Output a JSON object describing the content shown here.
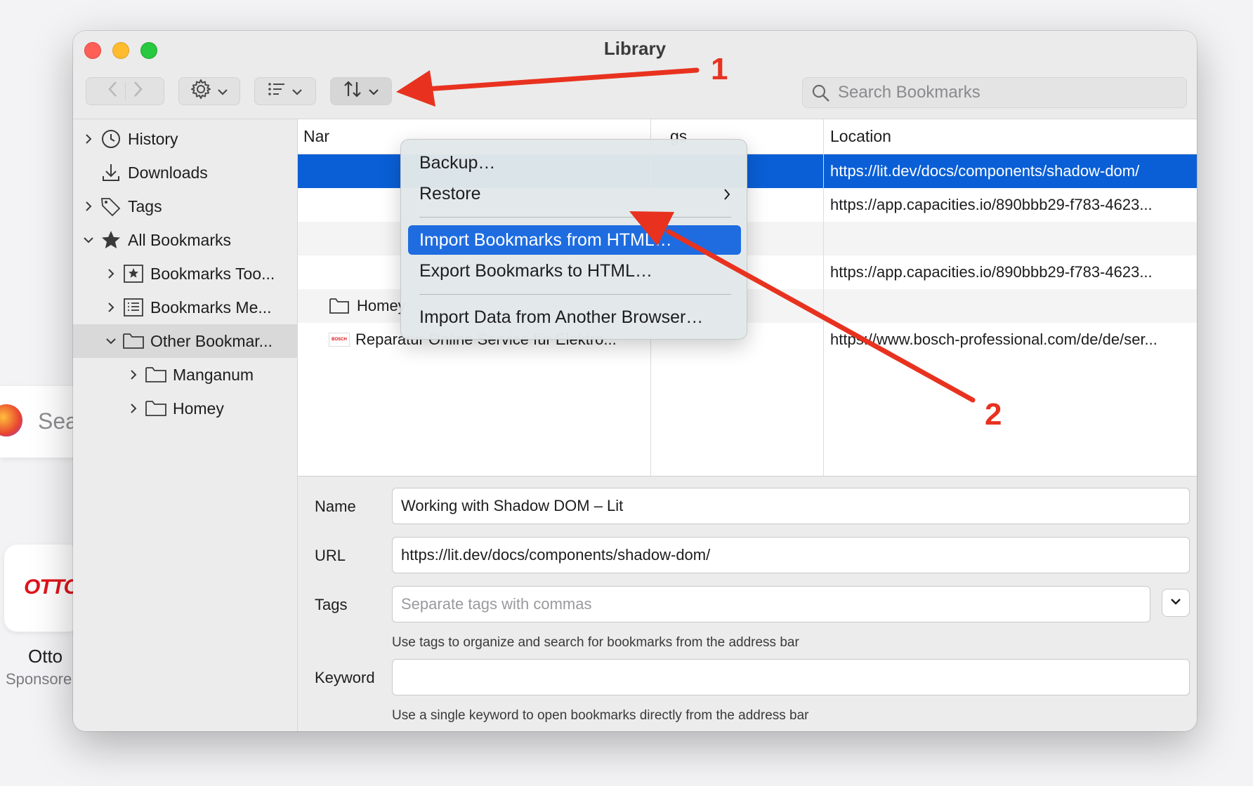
{
  "background": {
    "search_snippet": "Sea",
    "otto_logo": "OTTO",
    "otto_label": "Otto",
    "otto_sub": "Sponsore"
  },
  "window": {
    "title": "Library"
  },
  "toolbar": {
    "search_placeholder": "Search Bookmarks"
  },
  "sidebar": {
    "items": [
      {
        "label": "History",
        "icon": "clock-icon",
        "expandable": true,
        "expanded": false
      },
      {
        "label": "Downloads",
        "icon": "download-icon",
        "expandable": false
      },
      {
        "label": "Tags",
        "icon": "tag-icon",
        "expandable": true,
        "expanded": false
      },
      {
        "label": "All Bookmarks",
        "icon": "star-icon",
        "expandable": true,
        "expanded": true
      },
      {
        "label": "Bookmarks Too...",
        "icon": "bookmarks-toolbar-icon",
        "expandable": true,
        "expanded": false
      },
      {
        "label": "Bookmarks Me...",
        "icon": "bookmarks-menu-icon",
        "expandable": true,
        "expanded": false
      },
      {
        "label": "Other Bookmar...",
        "icon": "folder-icon",
        "expandable": true,
        "expanded": true,
        "selected": true
      },
      {
        "label": "Manganum",
        "icon": "folder-icon",
        "expandable": true,
        "expanded": false
      },
      {
        "label": "Homey",
        "icon": "folder-icon",
        "expandable": true,
        "expanded": false
      }
    ]
  },
  "table": {
    "columns": {
      "name": "Nar",
      "tags": "gs",
      "location": "Location"
    },
    "rows": [
      {
        "name": "",
        "tags": "",
        "location": "https://lit.dev/docs/components/shadow-dom/",
        "selected": true
      },
      {
        "name": "",
        "tags": "",
        "location": "https://app.capacities.io/890bbb29-f783-4623..."
      },
      {
        "name": "",
        "tags": "",
        "location": ""
      },
      {
        "name": "",
        "tags": "",
        "location": "https://app.capacities.io/890bbb29-f783-4623..."
      },
      {
        "name": "Homey",
        "tags": "",
        "location": ""
      },
      {
        "name": "Reparatur Online Service für Elektro...",
        "tags": "",
        "location": "https://www.bosch-professional.com/de/de/ser...",
        "favicon": "BOSCH"
      }
    ]
  },
  "menu": {
    "items": {
      "backup": "Backup…",
      "restore": "Restore",
      "import_html": "Import Bookmarks from HTML…",
      "export_html": "Export Bookmarks to HTML…",
      "import_browser": "Import Data from Another Browser…"
    }
  },
  "detail": {
    "name_label": "Name",
    "name_value": "Working with Shadow DOM – Lit",
    "url_label": "URL",
    "url_value": "https://lit.dev/docs/components/shadow-dom/",
    "tags_label": "Tags",
    "tags_placeholder": "Separate tags with commas",
    "tags_hint": "Use tags to organize and search for bookmarks from the address bar",
    "keyword_label": "Keyword",
    "keyword_value": "",
    "keyword_hint": "Use a single keyword to open bookmarks directly from the address bar"
  },
  "annotations": {
    "step1": "1",
    "step2": "2",
    "arrow_color": "#e8321f"
  }
}
